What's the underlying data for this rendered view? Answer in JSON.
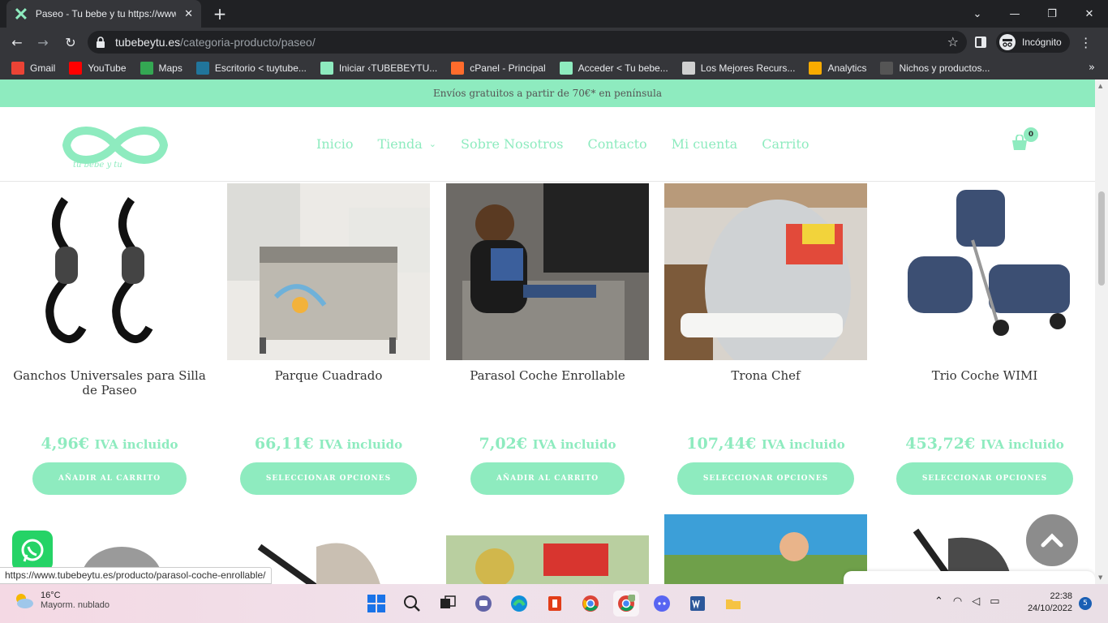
{
  "browser": {
    "tab_title": "Paseo - Tu bebe y tu https://www.",
    "url_host": "tubebeytu.es",
    "url_path": "/categoria-producto/paseo/",
    "incognito_label": "Incógnito",
    "bookmarks": [
      {
        "label": "Gmail",
        "icon": "gmail-icon",
        "color": "#ea4335"
      },
      {
        "label": "YouTube",
        "icon": "youtube-icon",
        "color": "#ff0000"
      },
      {
        "label": "Maps",
        "icon": "maps-icon",
        "color": "#34a853"
      },
      {
        "label": "Escritorio < tuytube...",
        "icon": "wordpress-icon",
        "color": "#21759b"
      },
      {
        "label": "Iniciar ‹TUBEBEYTU...",
        "icon": "infinity-icon",
        "color": "#8eebbf"
      },
      {
        "label": "cPanel - Principal",
        "icon": "cpanel-icon",
        "color": "#ff6c2c"
      },
      {
        "label": "Acceder < Tu bebe...",
        "icon": "x-icon",
        "color": "#8eebbf"
      },
      {
        "label": "Los Mejores Recurs...",
        "icon": "page-icon",
        "color": "#d0d0d0"
      },
      {
        "label": "Analytics",
        "icon": "analytics-icon",
        "color": "#f9ab00"
      },
      {
        "label": "Nichos y productos...",
        "icon": "dots-icon",
        "color": "#555555"
      }
    ],
    "status_url": "https://www.tubebeytu.es/producto/parasol-coche-enrollable/"
  },
  "site": {
    "promo": "Envíos gratuitos a partir de 70€* en península",
    "nav": [
      "Inicio",
      "Tienda",
      "Sobre Nosotros",
      "Contacto",
      "Mi cuenta",
      "Carrito"
    ],
    "cart_count": "0",
    "accent_color": "#8eebbf",
    "logo_text": "tu bebe y tu"
  },
  "products": [
    {
      "title": "Ganchos Universales para Silla de Paseo",
      "price": "4,96€",
      "price_suffix": "IVA incluido",
      "button": "Añadir al carrito"
    },
    {
      "title": "Parque Cuadrado",
      "price": "66,11€",
      "price_suffix": "IVA incluido",
      "button": "Seleccionar opciones"
    },
    {
      "title": "Parasol Coche Enrollable",
      "price": "7,02€",
      "price_suffix": "IVA incluido",
      "button": "Añadir al carrito"
    },
    {
      "title": "Trona Chef",
      "price": "107,44€",
      "price_suffix": "IVA incluido",
      "button": "Seleccionar opciones"
    },
    {
      "title": "Trio Coche WIMI",
      "price": "453,72€",
      "price_suffix": "IVA incluido",
      "button": "Seleccionar opciones"
    }
  ],
  "taskbar": {
    "temp": "16°C",
    "weather": "Mayorm. nublado",
    "time": "22:38",
    "date": "24/10/2022",
    "notifications": "5"
  }
}
